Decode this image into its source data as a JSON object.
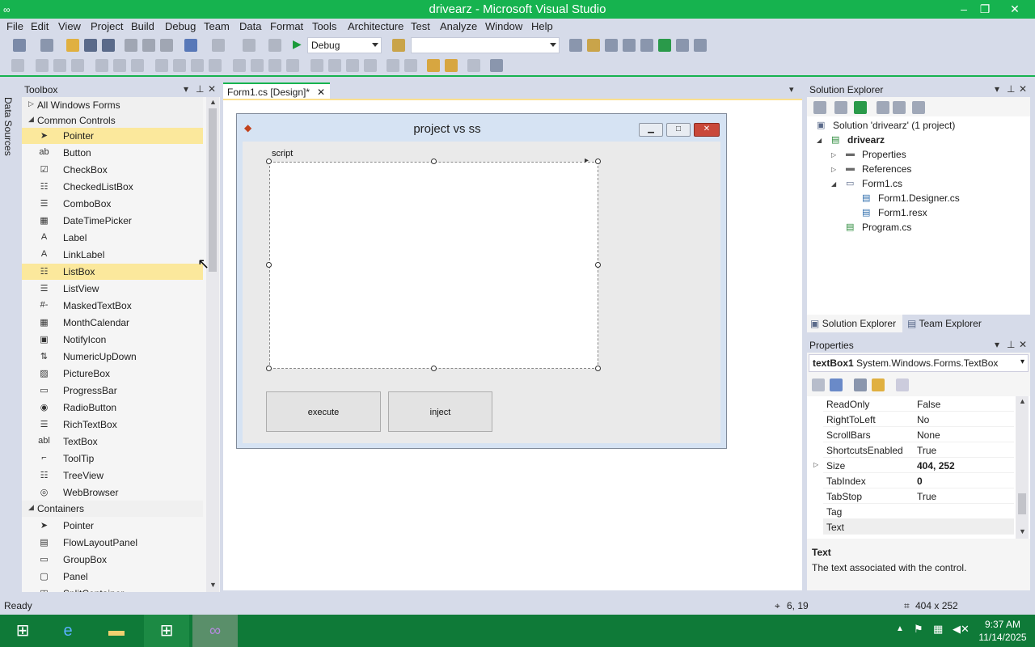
{
  "window": {
    "title": "drivearz - Microsoft Visual Studio"
  },
  "menu": [
    "File",
    "Edit",
    "View",
    "Project",
    "Build",
    "Debug",
    "Team",
    "Data",
    "Format",
    "Tools",
    "Architecture",
    "Test",
    "Analyze",
    "Window",
    "Help"
  ],
  "toolbar": {
    "config": "Debug",
    "platform": ""
  },
  "side_tab": {
    "label": "Data Sources"
  },
  "toolbox": {
    "title": "Toolbox",
    "groups": [
      {
        "label": "All Windows Forms",
        "expanded": false
      },
      {
        "label": "Common Controls",
        "expanded": true
      }
    ],
    "items": [
      {
        "label": "Pointer",
        "icon": "arrow-pointer-icon",
        "selected": true
      },
      {
        "label": "Button",
        "icon": "button-icon"
      },
      {
        "label": "CheckBox",
        "icon": "checkbox-icon"
      },
      {
        "label": "CheckedListBox",
        "icon": "checkedlistbox-icon"
      },
      {
        "label": "ComboBox",
        "icon": "combobox-icon"
      },
      {
        "label": "DateTimePicker",
        "icon": "calendar-icon"
      },
      {
        "label": "Label",
        "icon": "label-icon"
      },
      {
        "label": "LinkLabel",
        "icon": "linklabel-icon"
      },
      {
        "label": "ListBox",
        "icon": "listbox-icon",
        "selected": true
      },
      {
        "label": "ListView",
        "icon": "listview-icon"
      },
      {
        "label": "MaskedTextBox",
        "icon": "maskedtextbox-icon"
      },
      {
        "label": "MonthCalendar",
        "icon": "monthcalendar-icon"
      },
      {
        "label": "NotifyIcon",
        "icon": "notifyicon-icon"
      },
      {
        "label": "NumericUpDown",
        "icon": "numericupdown-icon"
      },
      {
        "label": "PictureBox",
        "icon": "picturebox-icon"
      },
      {
        "label": "ProgressBar",
        "icon": "progressbar-icon"
      },
      {
        "label": "RadioButton",
        "icon": "radio-icon"
      },
      {
        "label": "RichTextBox",
        "icon": "richtextbox-icon"
      },
      {
        "label": "TextBox",
        "icon": "textbox-icon"
      },
      {
        "label": "ToolTip",
        "icon": "tooltip-icon"
      },
      {
        "label": "TreeView",
        "icon": "treeview-icon"
      },
      {
        "label": "WebBrowser",
        "icon": "webbrowser-icon"
      }
    ],
    "containers_group": "Containers",
    "container_items": [
      {
        "label": "Pointer",
        "icon": "arrow-pointer-icon"
      },
      {
        "label": "FlowLayoutPanel",
        "icon": "flowlayout-icon"
      },
      {
        "label": "GroupBox",
        "icon": "groupbox-icon"
      },
      {
        "label": "Panel",
        "icon": "panel-icon"
      },
      {
        "label": "SplitContainer",
        "icon": "splitcontainer-icon"
      }
    ]
  },
  "document": {
    "tab_label": "Form1.cs [Design]*",
    "form_title": "project vs ss",
    "group_label": "script",
    "execute_label": "execute",
    "inject_label": "inject"
  },
  "solution_explorer": {
    "title": "Solution Explorer",
    "solution": "Solution 'drivearz' (1 project)",
    "project": "drivearz",
    "nodes": [
      "Properties",
      "References",
      "Form1.cs",
      "Form1.Designer.cs",
      "Form1.resx",
      "Program.cs"
    ],
    "tabs": [
      "Solution Explorer",
      "Team Explorer"
    ]
  },
  "properties": {
    "title": "Properties",
    "object": "textBox1",
    "object_type": "System.Windows.Forms.TextBox",
    "rows": [
      {
        "name": "ReadOnly",
        "value": "False"
      },
      {
        "name": "RightToLeft",
        "value": "No"
      },
      {
        "name": "ScrollBars",
        "value": "None"
      },
      {
        "name": "ShortcutsEnabled",
        "value": "True"
      },
      {
        "name": "Size",
        "value": "404, 252",
        "bold": true
      },
      {
        "name": "TabIndex",
        "value": "0",
        "bold": true
      },
      {
        "name": "TabStop",
        "value": "True"
      },
      {
        "name": "Tag",
        "value": ""
      },
      {
        "name": "Text",
        "value": ""
      }
    ],
    "desc_title": "Text",
    "desc_text": "The text associated with the control."
  },
  "status": {
    "text": "Ready",
    "position": "6, 19",
    "size": "404 x 252"
  },
  "taskbar": {
    "time": "9:37 AM",
    "date": "11/14/2025"
  },
  "colors": {
    "accent": "#16b34f",
    "chrome": "#d6dbe9",
    "selection": "#fbe89c"
  }
}
